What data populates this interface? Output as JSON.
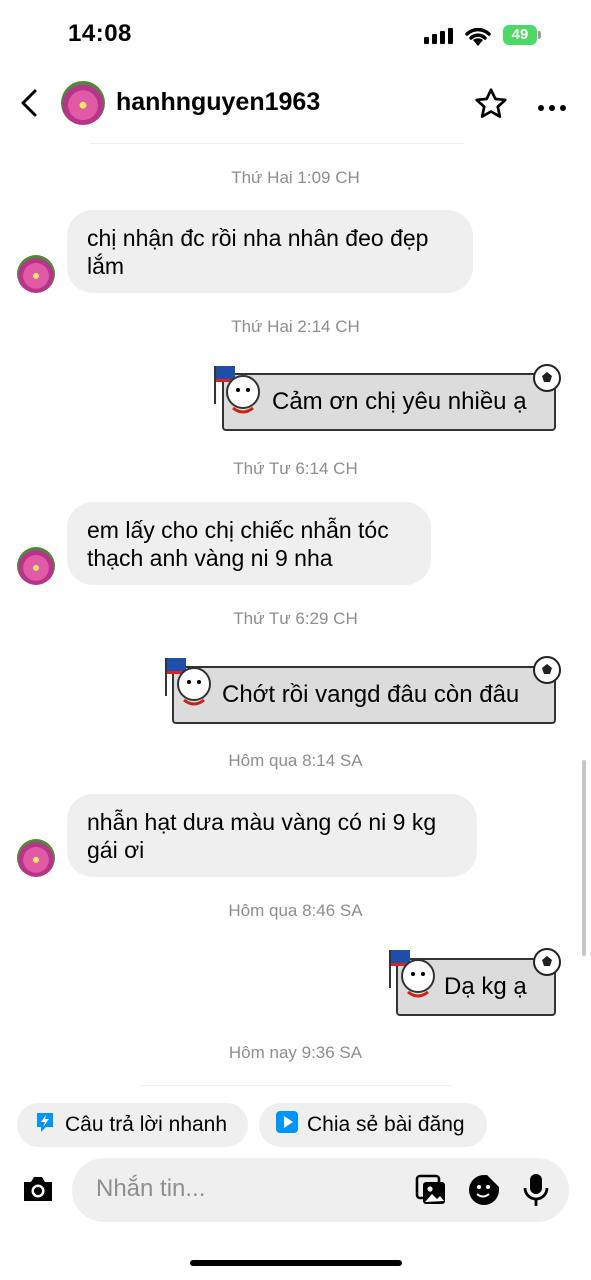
{
  "status_bar": {
    "time": "14:08",
    "battery": "49"
  },
  "header": {
    "username": "hanhnguyen1963"
  },
  "messages": [
    {
      "timestamp": "Thứ Hai 1:09 CH",
      "text": "chị nhận đc rồi nha nhân đeo đẹp lắm",
      "direction": "in"
    },
    {
      "timestamp": "Thứ Hai 2:14 CH",
      "text": "Cảm ơn chị yêu nhiều ạ",
      "direction": "out"
    },
    {
      "timestamp": "Thứ Tư 6:14 CH",
      "text": "em lấy cho chị chiếc nhẫn tóc thạch anh vàng ni 9 nha",
      "direction": "in"
    },
    {
      "timestamp": "Thứ Tư 6:29 CH",
      "text": "Chớt rồi vangd đâu còn đâu",
      "direction": "out"
    },
    {
      "timestamp": "Hôm qua 8:14 SA",
      "text": "nhẫn hạt dưa màu vàng có ni 9 kg gái ơi",
      "direction": "in"
    },
    {
      "timestamp": "Hôm qua 8:46 SA",
      "text": "Dạ kg ạ",
      "direction": "out"
    },
    {
      "timestamp": "Hôm nay 9:36 SA"
    }
  ],
  "quick_actions": {
    "quick_reply": "Câu trả lời nhanh",
    "share_post": "Chia sẻ bài đăng"
  },
  "composer": {
    "placeholder": "Nhắn tin..."
  },
  "colors": {
    "accent_blue": "#0095f6",
    "bubble_gray": "#efefef",
    "timestamp_gray": "#8e8e8e",
    "battery_green": "#4cd964"
  },
  "icons": [
    "back-icon",
    "star-icon",
    "more-icon",
    "camera-icon",
    "gallery-icon",
    "sticker-icon",
    "microphone-icon",
    "lightning-icon",
    "share-icon"
  ]
}
